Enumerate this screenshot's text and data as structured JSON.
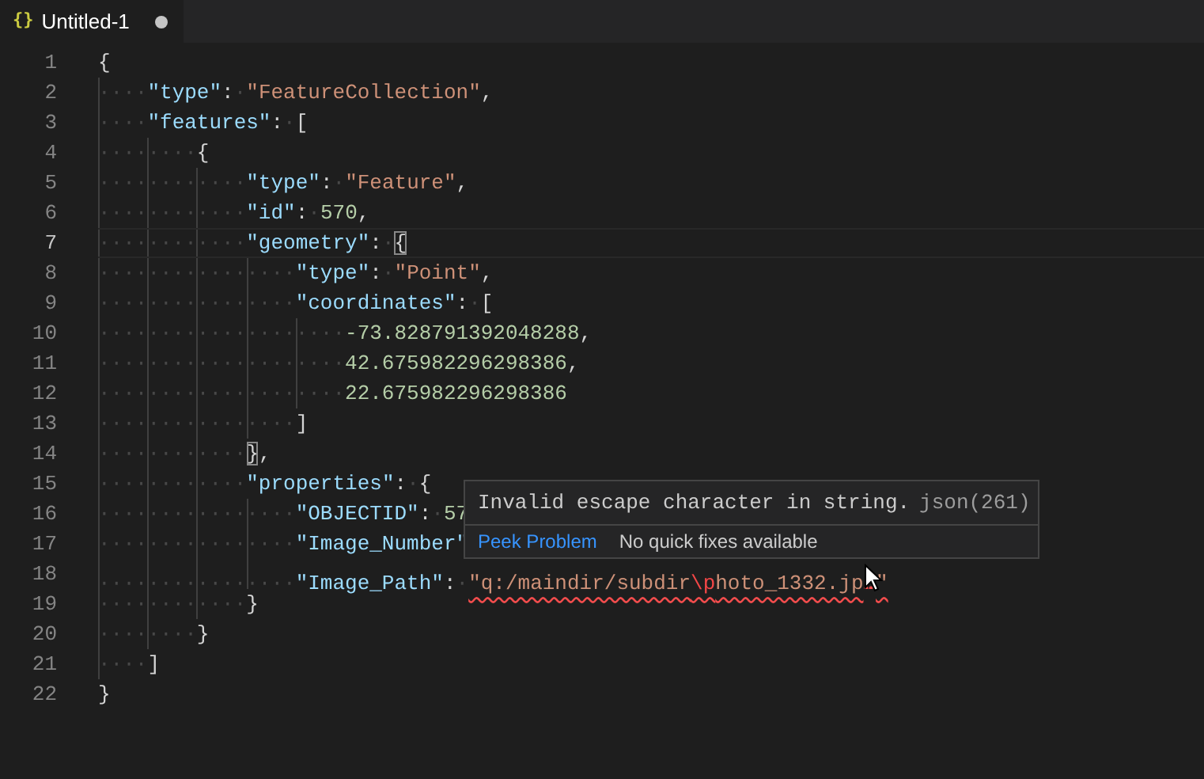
{
  "tab": {
    "title": "Untitled-1",
    "icon": "{}",
    "dirty": true
  },
  "lines": [
    {
      "number": "1",
      "active": false,
      "tokens": [
        {
          "kind": "bracket",
          "text": "{",
          "matched": false
        }
      ]
    },
    {
      "number": "2",
      "active": false,
      "tokens": [
        {
          "kind": "ws",
          "text": "····"
        },
        {
          "kind": "key",
          "text": "\"type\""
        },
        {
          "kind": "punct",
          "text": ":"
        },
        {
          "kind": "ws",
          "text": "·"
        },
        {
          "kind": "string",
          "text": "\"FeatureCollection\""
        },
        {
          "kind": "punct",
          "text": ","
        }
      ]
    },
    {
      "number": "3",
      "active": false,
      "tokens": [
        {
          "kind": "ws",
          "text": "····"
        },
        {
          "kind": "key",
          "text": "\"features\""
        },
        {
          "kind": "punct",
          "text": ":"
        },
        {
          "kind": "ws",
          "text": "·"
        },
        {
          "kind": "bracket",
          "text": "[",
          "matched": false
        }
      ]
    },
    {
      "number": "4",
      "active": false,
      "tokens": [
        {
          "kind": "ws",
          "text": "········"
        },
        {
          "kind": "bracket",
          "text": "{",
          "matched": false
        }
      ]
    },
    {
      "number": "5",
      "active": false,
      "tokens": [
        {
          "kind": "ws",
          "text": "············"
        },
        {
          "kind": "key",
          "text": "\"type\""
        },
        {
          "kind": "punct",
          "text": ":"
        },
        {
          "kind": "ws",
          "text": "·"
        },
        {
          "kind": "string",
          "text": "\"Feature\""
        },
        {
          "kind": "punct",
          "text": ","
        }
      ]
    },
    {
      "number": "6",
      "active": false,
      "tokens": [
        {
          "kind": "ws",
          "text": "············"
        },
        {
          "kind": "key",
          "text": "\"id\""
        },
        {
          "kind": "punct",
          "text": ":"
        },
        {
          "kind": "ws",
          "text": "·"
        },
        {
          "kind": "number",
          "text": "570"
        },
        {
          "kind": "punct",
          "text": ","
        }
      ]
    },
    {
      "number": "7",
      "active": true,
      "tokens": [
        {
          "kind": "ws",
          "text": "············"
        },
        {
          "kind": "key",
          "text": "\"geometry\""
        },
        {
          "kind": "punct",
          "text": ":"
        },
        {
          "kind": "ws",
          "text": "·"
        },
        {
          "kind": "bracket",
          "text": "{",
          "matched": true
        }
      ]
    },
    {
      "number": "8",
      "active": false,
      "tokens": [
        {
          "kind": "ws",
          "text": "················"
        },
        {
          "kind": "key",
          "text": "\"type\""
        },
        {
          "kind": "punct",
          "text": ":"
        },
        {
          "kind": "ws",
          "text": "·"
        },
        {
          "kind": "string",
          "text": "\"Point\""
        },
        {
          "kind": "punct",
          "text": ","
        }
      ]
    },
    {
      "number": "9",
      "active": false,
      "tokens": [
        {
          "kind": "ws",
          "text": "················"
        },
        {
          "kind": "key",
          "text": "\"coordinates\""
        },
        {
          "kind": "punct",
          "text": ":"
        },
        {
          "kind": "ws",
          "text": "·"
        },
        {
          "kind": "bracket",
          "text": "[",
          "matched": false
        }
      ]
    },
    {
      "number": "10",
      "active": false,
      "tokens": [
        {
          "kind": "ws",
          "text": "····················"
        },
        {
          "kind": "number",
          "text": "-73.828791392048288"
        },
        {
          "kind": "punct",
          "text": ","
        }
      ]
    },
    {
      "number": "11",
      "active": false,
      "tokens": [
        {
          "kind": "ws",
          "text": "····················"
        },
        {
          "kind": "number",
          "text": "42.675982296298386"
        },
        {
          "kind": "punct",
          "text": ","
        }
      ]
    },
    {
      "number": "12",
      "active": false,
      "tokens": [
        {
          "kind": "ws",
          "text": "····················"
        },
        {
          "kind": "number",
          "text": "22.675982296298386"
        }
      ]
    },
    {
      "number": "13",
      "active": false,
      "tokens": [
        {
          "kind": "ws",
          "text": "················"
        },
        {
          "kind": "bracket",
          "text": "]",
          "matched": false
        }
      ]
    },
    {
      "number": "14",
      "active": false,
      "tokens": [
        {
          "kind": "ws",
          "text": "············"
        },
        {
          "kind": "bracket",
          "text": "}",
          "matched": true
        },
        {
          "kind": "punct",
          "text": ","
        }
      ]
    },
    {
      "number": "15",
      "active": false,
      "tokens": [
        {
          "kind": "ws",
          "text": "············"
        },
        {
          "kind": "key",
          "text": "\"properties\""
        },
        {
          "kind": "punct",
          "text": ":"
        },
        {
          "kind": "ws",
          "text": "·"
        },
        {
          "kind": "bracket",
          "text": "{",
          "matched": false
        }
      ]
    },
    {
      "number": "16",
      "active": false,
      "tokens": [
        {
          "kind": "ws",
          "text": "················"
        },
        {
          "kind": "key",
          "text": "\"OBJECTID\""
        },
        {
          "kind": "punct",
          "text": ":"
        },
        {
          "kind": "ws",
          "text": "·"
        },
        {
          "kind": "number",
          "text": "57"
        }
      ]
    },
    {
      "number": "17",
      "active": false,
      "tokens": [
        {
          "kind": "ws",
          "text": "················"
        },
        {
          "kind": "key",
          "text": "\"Image_Number\""
        }
      ]
    },
    {
      "number": "18",
      "active": false,
      "tokens": [
        {
          "kind": "ws",
          "text": "················"
        },
        {
          "kind": "key",
          "text": "\"Image_Path\""
        },
        {
          "kind": "punct",
          "text": ":"
        },
        {
          "kind": "ws",
          "text": "·"
        },
        {
          "kind": "string",
          "text": "\"q:/maindir/subdir",
          "error": true
        },
        {
          "kind": "escape",
          "text": "\\p",
          "error": true
        },
        {
          "kind": "string",
          "text": "hoto_1332.jp",
          "error": true
        },
        {
          "kind": "covered",
          "error": true
        },
        {
          "kind": "string",
          "text": "\"",
          "error": true
        }
      ]
    },
    {
      "number": "19",
      "active": false,
      "tokens": [
        {
          "kind": "ws",
          "text": "············"
        },
        {
          "kind": "bracket",
          "text": "}",
          "matched": false
        }
      ]
    },
    {
      "number": "20",
      "active": false,
      "tokens": [
        {
          "kind": "ws",
          "text": "········"
        },
        {
          "kind": "bracket",
          "text": "}",
          "matched": false
        }
      ]
    },
    {
      "number": "21",
      "active": false,
      "tokens": [
        {
          "kind": "ws",
          "text": "····"
        },
        {
          "kind": "bracket",
          "text": "]",
          "matched": false
        }
      ]
    },
    {
      "number": "22",
      "active": false,
      "tokens": [
        {
          "kind": "bracket",
          "text": "}",
          "matched": false
        }
      ]
    }
  ],
  "hover": {
    "message": "Invalid escape character in string.",
    "source": "json(261)",
    "action": "Peek Problem",
    "status": "No quick fixes available"
  }
}
